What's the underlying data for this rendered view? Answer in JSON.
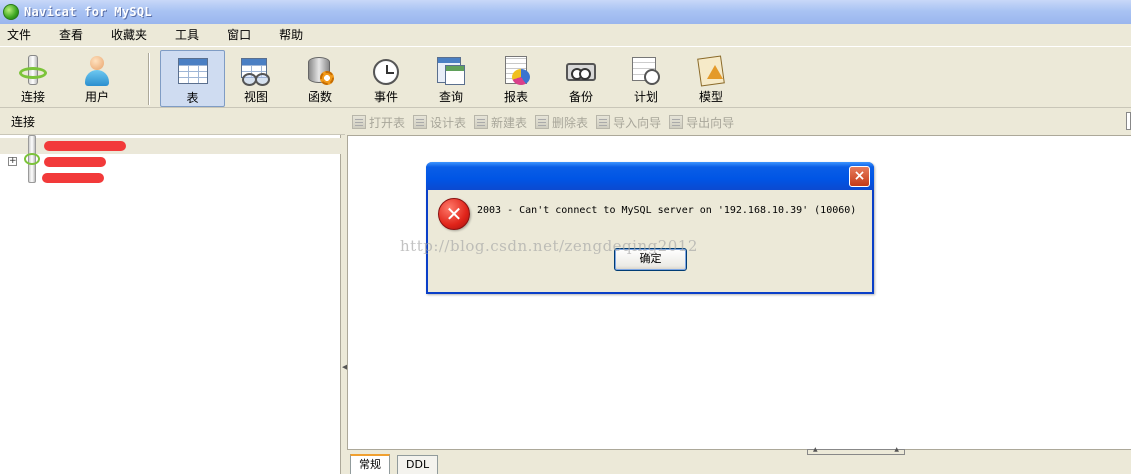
{
  "window": {
    "title": "Navicat for MySQL"
  },
  "menu": [
    "文件",
    "查看",
    "收藏夹",
    "工具",
    "窗口",
    "帮助"
  ],
  "toolbar": {
    "connect": "连接",
    "user": "用户",
    "table": "表",
    "view": "视图",
    "function": "函数",
    "event": "事件",
    "query": "查询",
    "report": "报表",
    "backup": "备份",
    "schedule": "计划",
    "model": "模型"
  },
  "connections_header": "连接",
  "object_toolbar": [
    "打开表",
    "设计表",
    "新建表",
    "删除表",
    "导入向导",
    "导出向导"
  ],
  "tabs": [
    "常规",
    "DDL"
  ],
  "dialog": {
    "message": "2003 - Can't connect to MySQL server on '192.168.10.39' (10060)",
    "ok": "确定",
    "close": "×"
  },
  "watermark": "http://blog.csdn.net/zengdeqing2012",
  "icons": {
    "app": "navicat-icon",
    "error": "error-icon"
  },
  "colors": {
    "dialog_title": "#0055e5",
    "error": "#e0241a",
    "redaction": "#f23a3a",
    "selected_tool": "#cfdcf1"
  }
}
